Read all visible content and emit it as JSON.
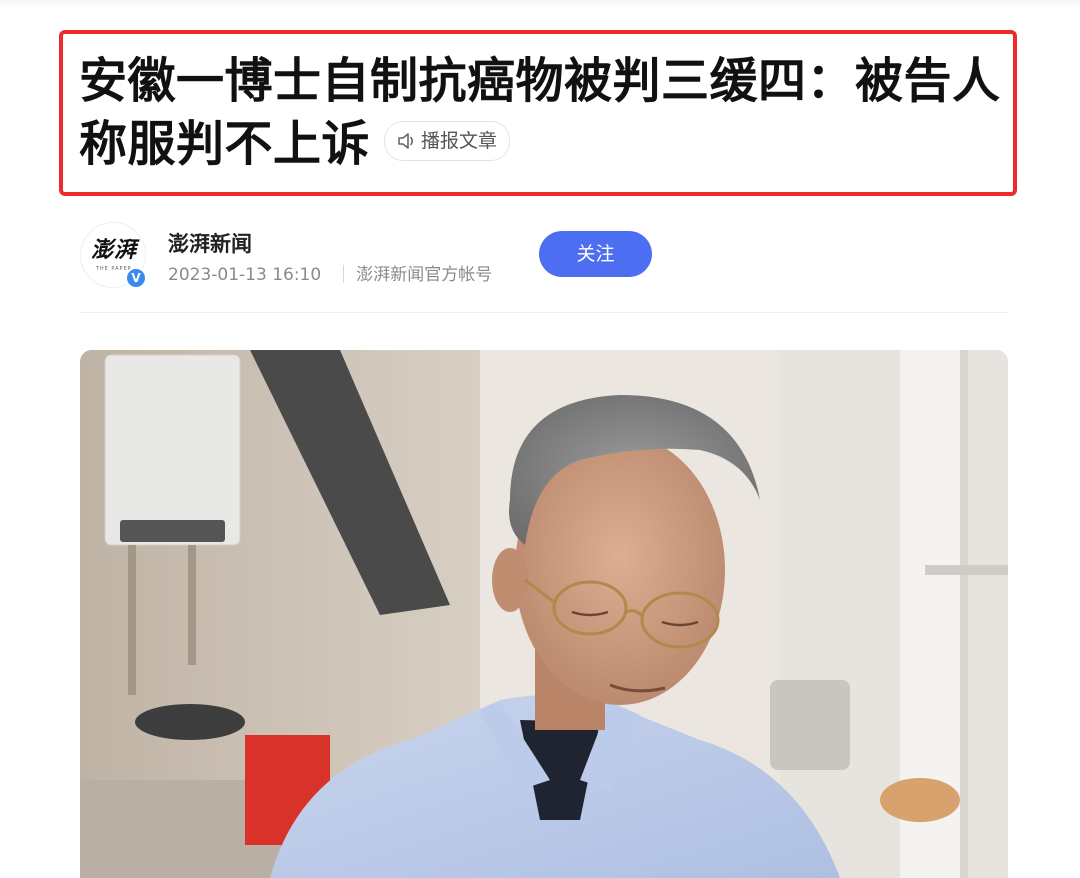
{
  "article": {
    "title": "安徽一博士自制抗癌物被判三缓四：被告人称服判不上诉",
    "listen_label": "播报文章"
  },
  "author": {
    "name": "澎湃新闻",
    "avatar_logo_text": "澎湃",
    "avatar_sub_text": "THE PAPER",
    "verified_mark": "V",
    "timestamp": "2023-01-13 16:10",
    "account_type": "澎湃新闻官方帐号",
    "follow_label": "关注"
  },
  "colors": {
    "highlight_frame": "#ef2a2a",
    "follow_button": "#4e6ef2",
    "verified_badge": "#3a8bf0"
  },
  "icons": {
    "listen": "speaker-icon",
    "verified": "verified-badge-icon"
  }
}
